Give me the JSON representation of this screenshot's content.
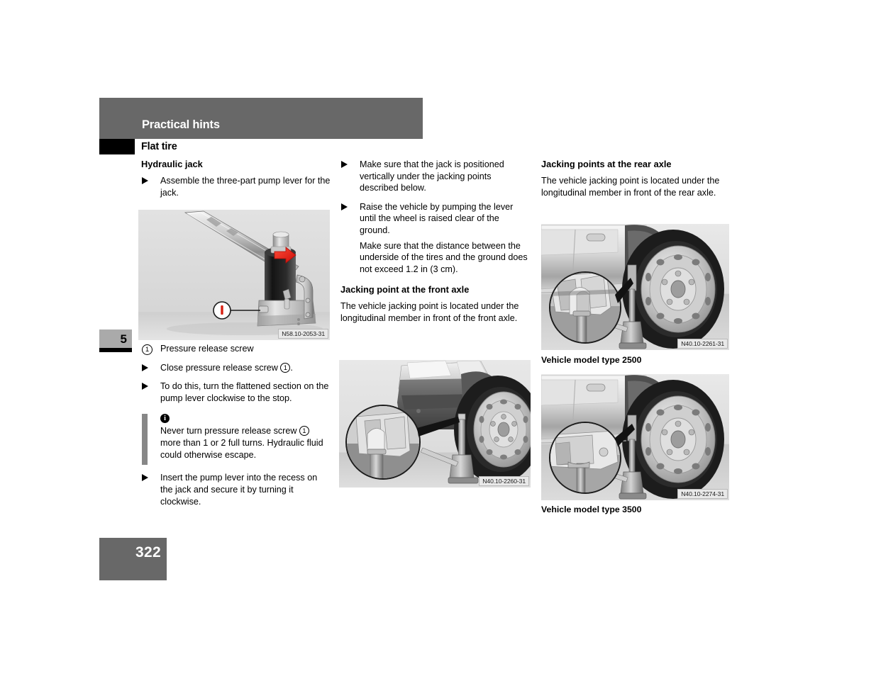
{
  "header": {
    "chapter_title": "Practical hints",
    "section_title": "Flat tire",
    "chapter_number": "5",
    "page_number": "322"
  },
  "columns": {
    "left": {
      "heading": "Hydraulic jack",
      "bullet_1": "Assemble the three-part pump lever for the jack.",
      "legend_1_number": "1",
      "legend_1_text": "Pressure release screw",
      "bullet_2_pre": "Close pressure release screw ",
      "bullet_2_number": "1",
      "bullet_2_post": ".",
      "bullet_3": "To do this, turn the flattened section on the pump lever clockwise to the stop.",
      "note_icon": "info-icon",
      "note_pre": "Never turn pressure release screw ",
      "note_number": "1",
      "note_post": " more than 1 or 2 full turns. Hydraulic fluid could otherwise escape.",
      "bullet_4": "Insert the pump lever into the recess on the jack and secure it by turning it clockwise."
    },
    "middle": {
      "bullet_1": "Make sure that the jack is positioned vertically under the jacking points described below.",
      "bullet_2": "Raise the vehicle by pumping the lever until the wheel is raised clear of the ground.",
      "subpara_1": "Make sure that the distance between the underside of the tires and the ground does not exceed 1.2 in (3 cm).",
      "heading": "Jacking point at the front axle",
      "body": "The vehicle jacking point is located under the longitudinal member in front of the front axle."
    },
    "right": {
      "heading": "Jacking points at the rear axle",
      "body": "The vehicle jacking point is located under the longitudinal member in front of the rear axle."
    }
  },
  "figures": [
    {
      "name": "hydraulic-jack-figure",
      "id_label": "N58.10-2053-31",
      "callout_number": "1",
      "caption": ""
    },
    {
      "name": "front-axle-jacking-point-figure",
      "id_label": "N40.10-2260-31",
      "caption": ""
    },
    {
      "name": "rear-axle-jacking-point-2500-figure",
      "id_label": "N40.10-2261-31",
      "caption": "Vehicle model type 2500"
    },
    {
      "name": "rear-axle-jacking-point-3500-figure",
      "id_label": "N40.10-2274-31",
      "caption": "Vehicle model type 3500"
    }
  ],
  "colors": {
    "header_gray": "#686868",
    "tab_gray": "#aaaaaa",
    "figure_bg": "#d9d9d9",
    "note_bar": "#878787",
    "arrow_red": "#e8231a"
  }
}
